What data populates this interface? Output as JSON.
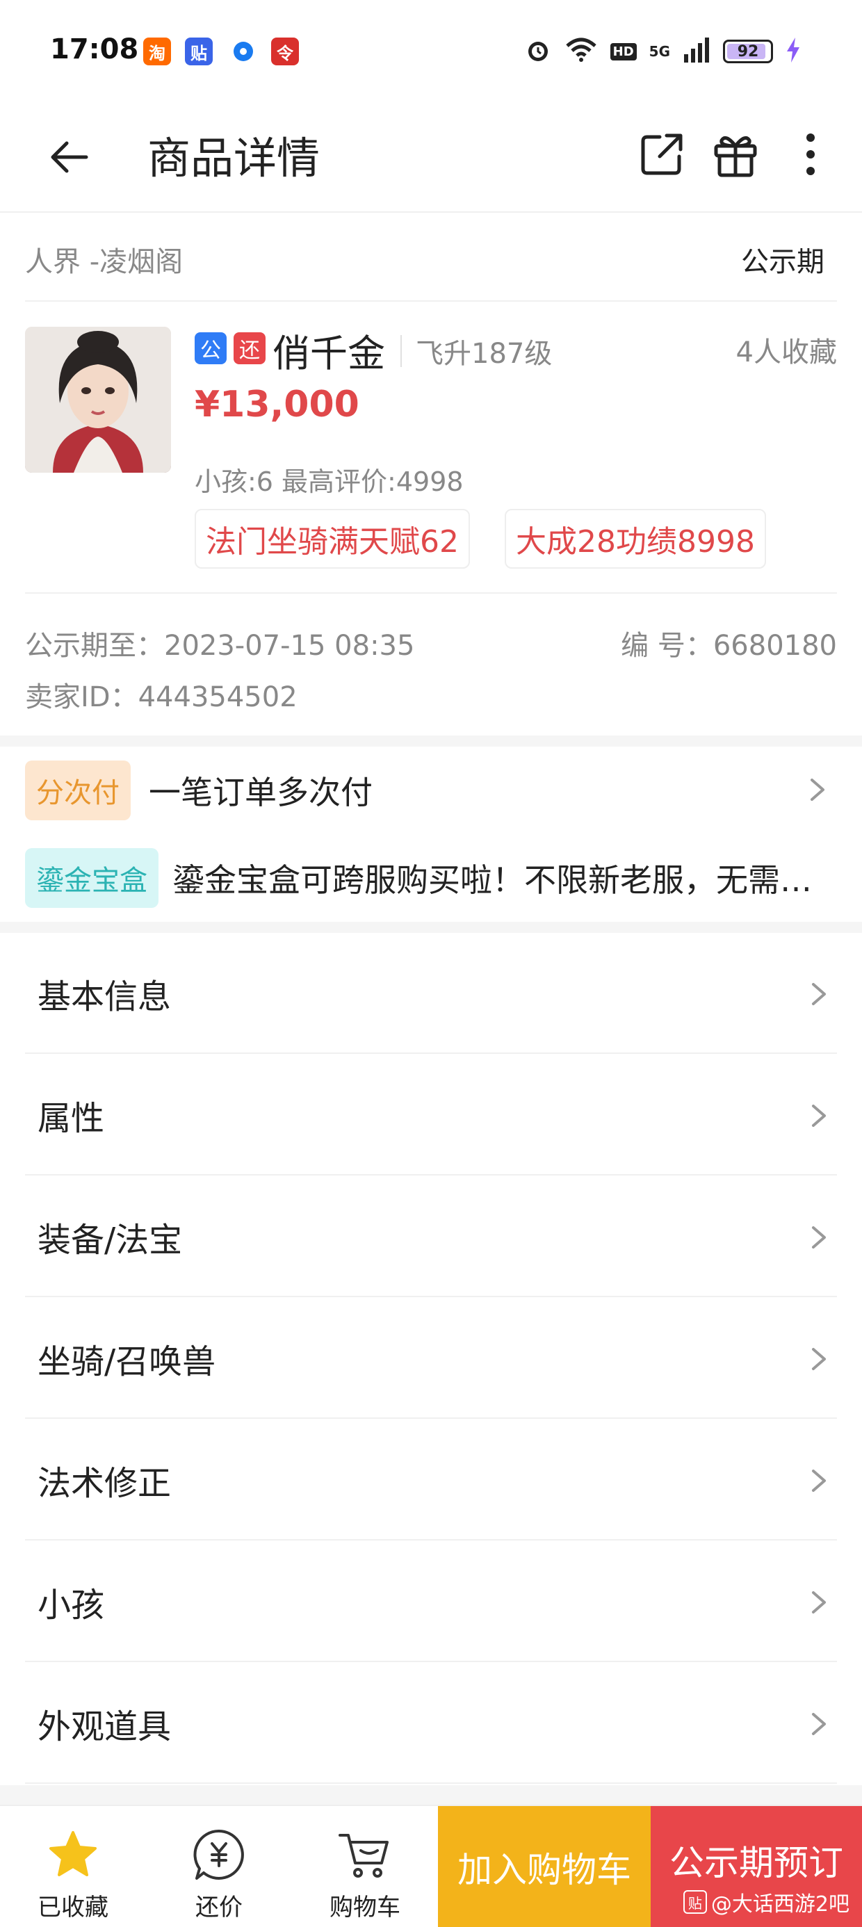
{
  "status_bar": {
    "time": "17:08",
    "app_icons": [
      "taobao-icon",
      "tieba-icon",
      "browser-icon",
      "redpacket-icon"
    ],
    "app_icon_glyphs": [
      "淘",
      "贴",
      "",
      "令"
    ],
    "app_icon_colors": [
      "#ff6a00",
      "#3a64e8",
      "#1a7bf0",
      "#d9302c"
    ],
    "hd": "HD",
    "network": "5G",
    "battery": "92",
    "battery_level": 0.92
  },
  "header": {
    "title": "商品详情"
  },
  "server": {
    "name": "人界 -凌烟阁",
    "phase": "公示期"
  },
  "product": {
    "badge_public": "公",
    "badge_return": "还",
    "badge_public_color": "#2f7cf6",
    "badge_return_color": "#e8464a",
    "name": "俏千金",
    "level": "飞升187级",
    "favorites": "4人收藏",
    "price": "¥13,000",
    "stats": "小孩:6 最高评价:4998",
    "tags": [
      "法门坐骑满天赋62",
      "大成28功绩8998"
    ]
  },
  "meta": {
    "public_until": "公示期至：2023-07-15 08:35",
    "serial": "编    号：6680180",
    "seller": "卖家ID：444354502"
  },
  "promos": [
    {
      "badge": "分次付",
      "text": "一笔订单多次付",
      "badge_bg": "#fde6cf",
      "badge_color": "#e8962e"
    },
    {
      "badge": "鎏金宝盒",
      "text": "鎏金宝盒可跨服购买啦！不限新老服，无需…",
      "badge_bg": "#d7f6f6",
      "badge_color": "#2bb3b3"
    }
  ],
  "menu": [
    "基本信息",
    "属性",
    "装备/法宝",
    "坐骑/召唤兽",
    "法术修正",
    "小孩",
    "外观道具"
  ],
  "bottom_bar": {
    "favorited": "已收藏",
    "bargain": "还价",
    "cart": "购物车",
    "add_to_cart": "加入购物车",
    "reserve": "公示期预订",
    "watermark": "@大话西游2吧",
    "watermark_logo": "贴"
  },
  "colors": {
    "price_red": "#e0484a",
    "cart_yellow": "#f3b31a",
    "reserve_red": "#e8464a",
    "star_yellow": "#f6c21b"
  }
}
